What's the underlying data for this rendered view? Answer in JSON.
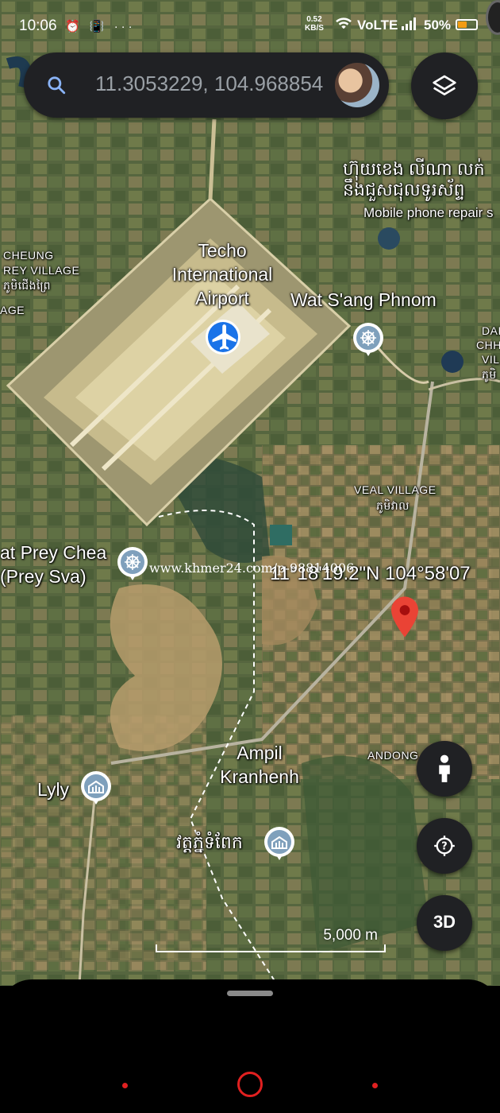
{
  "status_bar": {
    "time": "10:06",
    "icons": "⏰ 📳 ···",
    "net_speed_value": "0.52",
    "net_speed_unit": "KB/S",
    "network": "VoLTE",
    "battery": "50%",
    "battery_level": 0.5
  },
  "search": {
    "query": "11.3053229, 104.968854",
    "icon": "search-icon"
  },
  "map": {
    "labels": {
      "airport_line1": "Techo",
      "airport_line2": "International",
      "airport_line3": "Airport",
      "wat_sang_phnom": "Wat S'ang Phnom",
      "khmer_shop_line1": "ហ៊ុយខេង លីណា លក់",
      "khmer_shop_line2": "នឹងជួសជុលទូរស័ព្ទ",
      "mobile_repair": "Mobile phone repair s",
      "cheung": "CHEUNG",
      "prey_village": "REY VILLAGE",
      "khmer_village": "ភូមិជើងព្រៃ",
      "age": "AGE",
      "dam_1": "DAI",
      "dam_2": "CHH",
      "dam_3": "VIL",
      "dam_4": "ភូមិ",
      "veal_village": "VEAL VILLAGE",
      "veal_khmer": "ភូមិវាល",
      "wat_prey_chea_1": "at Prey Chea",
      "wat_prey_chea_2": "(Prey Sva)",
      "coordinates": "11°18'19.2\"N 104°58'07",
      "andong": "ANDONG",
      "ampil_1": "Ampil",
      "ampil_2": "Kranhenh",
      "lyly": "Lyly",
      "khmer_pagoda": "វត្តភ្នំទំពែក"
    },
    "watermark": "www.khmer24.com/p-98814006",
    "scale_label": "5,000 m"
  },
  "buttons": {
    "three_d": "3D"
  },
  "colors": {
    "accent_blue": "#1a73e8",
    "pin_red": "#ea4335",
    "dark_ui": "#202124"
  }
}
